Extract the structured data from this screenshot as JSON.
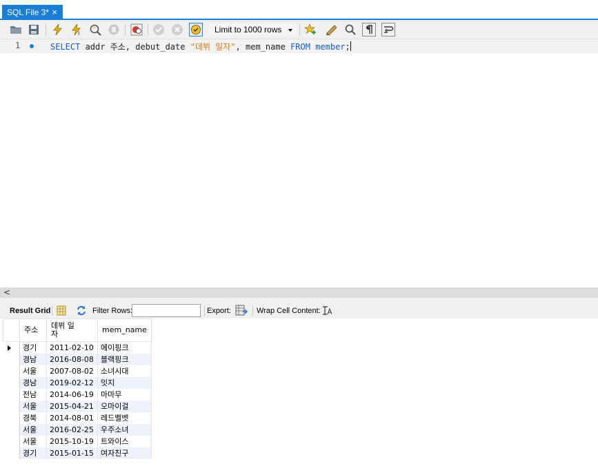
{
  "tab": {
    "title": "SQL File 3*",
    "close": "×"
  },
  "toolbar": {
    "limit_label": "Limit to 1000 rows",
    "icons": [
      "open-folder-icon",
      "save-icon",
      "execute-icon",
      "execute-current-icon",
      "explain-icon",
      "stop-icon",
      "toggle-error-icon",
      "commit-icon",
      "rollback-icon",
      "autocommit-icon",
      "limit-dropdown",
      "add-snippet-icon",
      "beautify-icon",
      "find-icon",
      "invisible-chars-icon",
      "wrap-icon"
    ]
  },
  "editor": {
    "line_number": "1",
    "tokens": [
      {
        "text": "SELECT",
        "kind": "kw"
      },
      {
        "text": " addr 주소, debut_date ",
        "kind": "plain"
      },
      {
        "text": "\"데뷔 일자\"",
        "kind": "str"
      },
      {
        "text": ", mem_name ",
        "kind": "plain"
      },
      {
        "text": "FROM",
        "kind": "kw"
      },
      {
        "text": " ",
        "kind": "plain"
      },
      {
        "text": "member",
        "kind": "kw"
      },
      {
        "text": ";",
        "kind": "plain"
      }
    ]
  },
  "result_toolbar": {
    "result_grid_label": "Result Grid",
    "filter_rows_label": "Filter Rows:",
    "filter_value": "",
    "export_label": "Export:",
    "wrap_label": "Wrap Cell Content:"
  },
  "grid": {
    "columns": [
      "주소",
      "데뷔 일\n자",
      "mem_name"
    ],
    "rows": [
      [
        "경기",
        "2011-02-10",
        "에이핑크"
      ],
      [
        "경남",
        "2016-08-08",
        "블랙핑크"
      ],
      [
        "서울",
        "2007-08-02",
        "소녀시대"
      ],
      [
        "경남",
        "2019-02-12",
        "잇지"
      ],
      [
        "전남",
        "2014-06-19",
        "마마무"
      ],
      [
        "서울",
        "2015-04-21",
        "오마이걸"
      ],
      [
        "경북",
        "2014-08-01",
        "레드벨벳"
      ],
      [
        "서울",
        "2016-02-25",
        "우주소녀"
      ],
      [
        "서울",
        "2015-10-19",
        "트와이스"
      ],
      [
        "경기",
        "2015-01-15",
        "여자친구"
      ]
    ],
    "selected_row": 0
  }
}
